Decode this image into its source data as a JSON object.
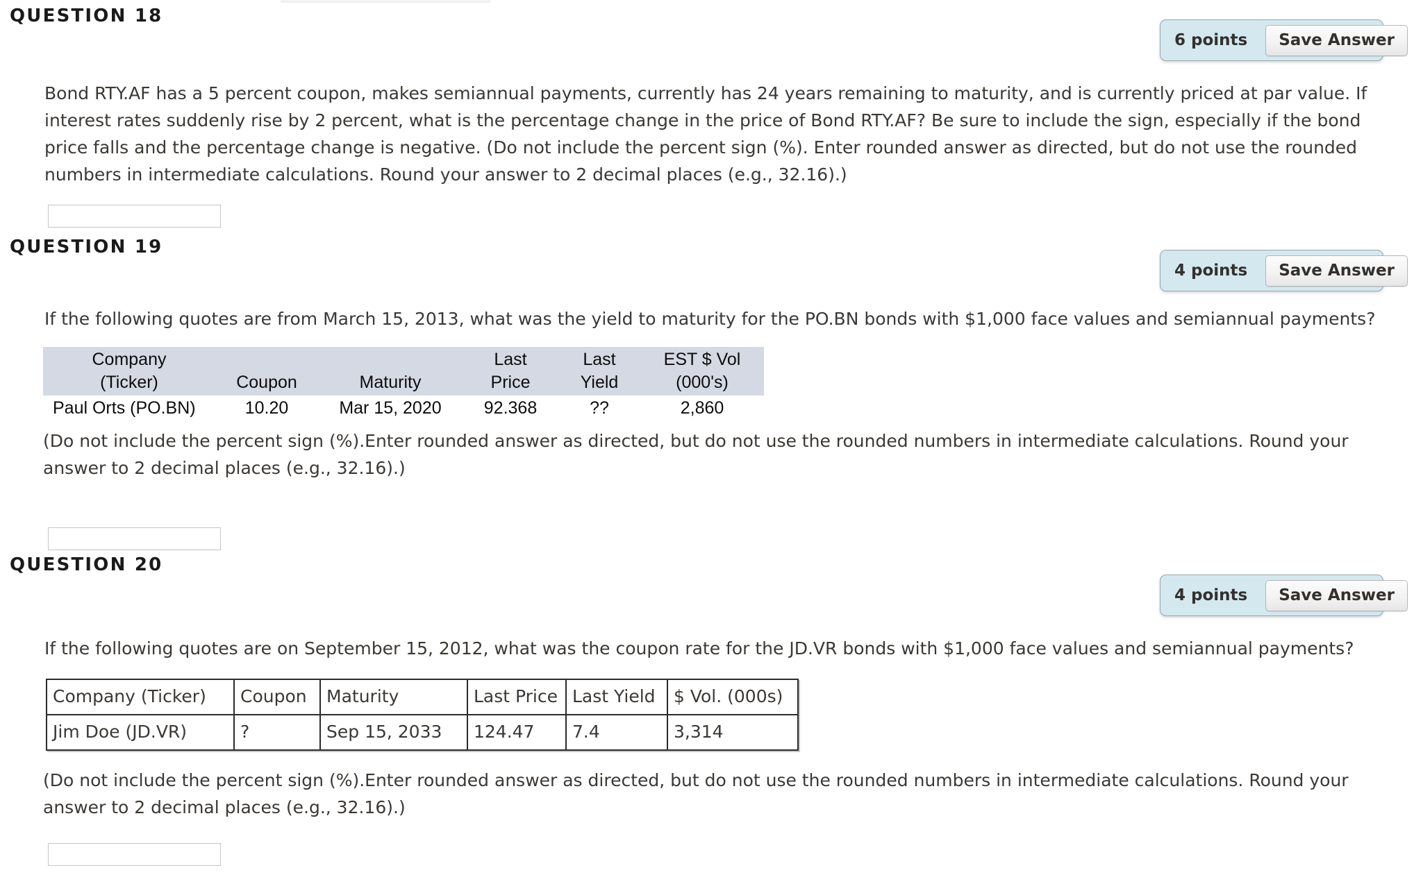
{
  "questions": [
    {
      "heading": "QUESTION 18",
      "points_label": "6 points",
      "save_label": "Save Answer",
      "body_lines": [
        "Bond RTY.AF has a 5 percent coupon, makes semiannual payments, currently has 24 years remaining to maturity, and is currently priced at par value. If",
        "interest rates suddenly rise by 2 percent, what is the percentage change in the price of Bond RTY.AF? Be sure to include the sign, especially if the bond",
        "price falls and the percentage change is negative. (Do not include the percent sign (%). Enter rounded answer as directed, but do not use the rounded",
        "numbers in intermediate calculations. Round your answer to 2 decimal places (e.g., 32.16).)"
      ],
      "answer_value": "",
      "answer_placeholder": ""
    },
    {
      "heading": "QUESTION 19",
      "points_label": "4 points",
      "save_label": "Save Answer",
      "body_lines": [
        "If the following quotes are from March 15, 2013, what was the yield to maturity for the PO.BN bonds with $1,000 face values and semiannual payments?"
      ],
      "note_lines": [
        "(Do not include the percent sign (%).Enter rounded answer as directed, but do not use the rounded numbers in intermediate calculations. Round your",
        "answer to 2 decimal places (e.g., 32.16).)"
      ],
      "answer_value": "",
      "answer_placeholder": "",
      "table": {
        "style": "shaded",
        "headers": [
          "Company\n(Ticker)",
          "Coupon",
          "Maturity",
          "Last\nPrice",
          "Last\nYield",
          "EST $ Vol\n(000's)"
        ],
        "rows": [
          [
            "Paul Orts (PO.BN)",
            "10.20",
            "Mar 15, 2020",
            "92.368",
            "??",
            "2,860"
          ]
        ]
      }
    },
    {
      "heading": "QUESTION 20",
      "points_label": "4 points",
      "save_label": "Save Answer",
      "body_lines": [
        "If the following quotes are on September 15, 2012, what was the coupon rate for the JD.VR bonds with $1,000 face values and semiannual payments?"
      ],
      "note_lines": [
        "(Do not include the percent sign (%).Enter rounded answer as directed, but do not use the rounded numbers in intermediate calculations. Round your",
        "answer to 2 decimal places (e.g., 32.16).)"
      ],
      "answer_value": "",
      "answer_placeholder": "",
      "table": {
        "style": "grid",
        "headers": [
          "Company (Ticker)",
          "Coupon",
          "Maturity",
          "Last Price",
          "Last Yield",
          "$ Vol. (000s)"
        ],
        "rows": [
          [
            "Jim Doe (JD.VR)",
            "?",
            "Sep 15, 2033",
            "124.47",
            "7.4",
            "3,314"
          ]
        ]
      }
    }
  ],
  "colors": {
    "pill_background": "#d3e9ef",
    "table_header_shade": "#d4d9e4",
    "page_background": "#ffffff",
    "text": "#3b3835"
  }
}
